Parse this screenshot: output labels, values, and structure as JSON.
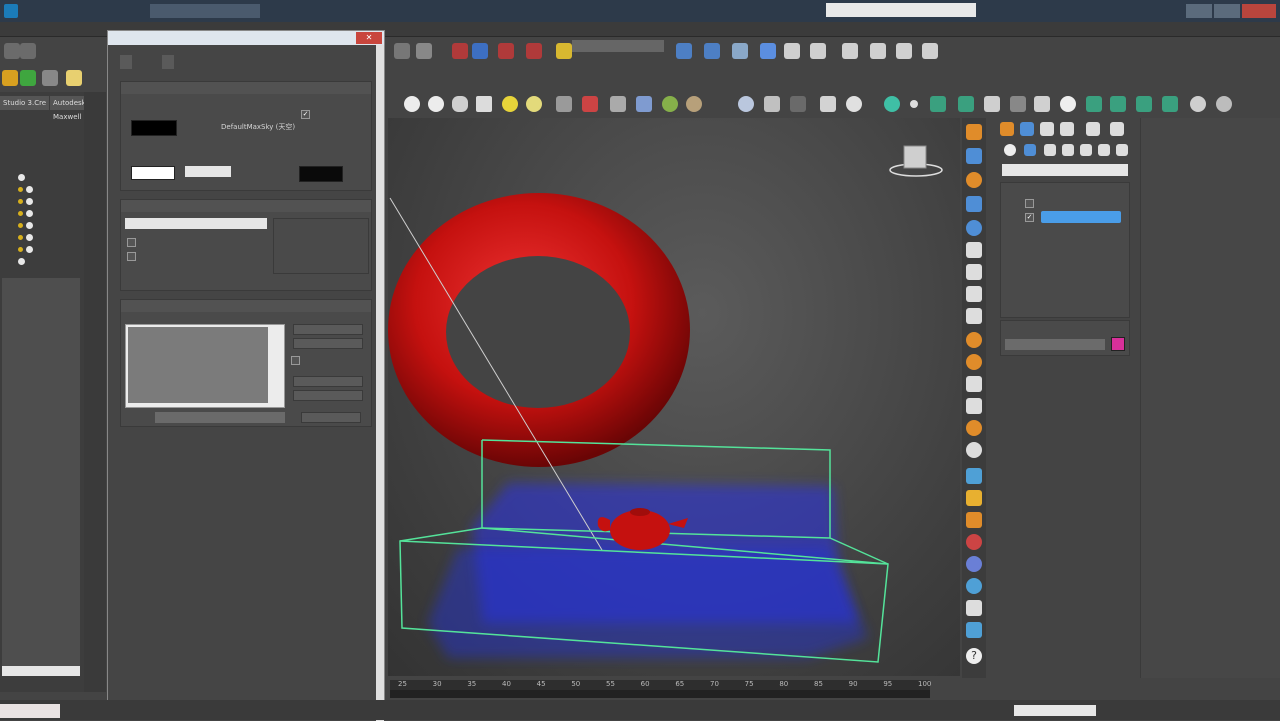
{
  "titlebar": {
    "app_title": "",
    "search_placeholder": "",
    "login_label": ""
  },
  "ribbon": {
    "items": [
      "",
      "",
      "",
      "",
      "",
      "",
      "",
      ""
    ]
  },
  "scene_explorer": {
    "tabs": [
      "Studio 3.Cre",
      "Autodesk Maxwell"
    ],
    "header_tabs": [
      "",
      ""
    ],
    "root_label": "",
    "objects": [
      "",
      "",
      "",
      "",
      "",
      "",
      "",
      ""
    ]
  },
  "dialog": {
    "title": "",
    "tabs": [
      "",
      ""
    ],
    "common_params": {
      "header": "",
      "background": {
        "section": "",
        "color_label": "",
        "env_map_label": "",
        "use_map_label": "",
        "map_name": "DefaultMaxSky (天空)"
      },
      "global_lighting": {
        "section": "",
        "tint_label": "",
        "level_label": "",
        "ambient_label": "",
        "level_value": ""
      }
    },
    "exposure_control": {
      "header": "",
      "dropdown_value": "",
      "active_label": "",
      "process_bg_label": "",
      "render_preview_label": ""
    },
    "atmosphere": {
      "header": "",
      "effects_label": "",
      "effect_item": "",
      "add_label": "",
      "delete_label": "",
      "active_label": "",
      "move_up_label": "",
      "move_down_label": "",
      "name_label": "",
      "merge_label": ""
    }
  },
  "viewport": {
    "colors": {
      "torus": "#c5110f",
      "teapot": "#c5110f",
      "particles": "#2b32e6",
      "box": "#54e39a"
    }
  },
  "timeline": {
    "ticks": [
      "25",
      "30",
      "35",
      "40",
      "45",
      "50",
      "55",
      "60",
      "65",
      "70",
      "75",
      "80",
      "85",
      "90",
      "95",
      "100"
    ]
  },
  "command_panel": {
    "category_dropdown": "",
    "object_type_header": "",
    "autogrid_label": "",
    "buttons": [
      "",
      "",
      "",
      "",
      "",
      "",
      "",
      "",
      "",
      "",
      "",
      "",
      "",
      "",
      ""
    ],
    "name_color_header": ""
  },
  "statusbar": {
    "left_text": "",
    "grid_text": "",
    "autokey_label": "",
    "set_key_label": ""
  }
}
